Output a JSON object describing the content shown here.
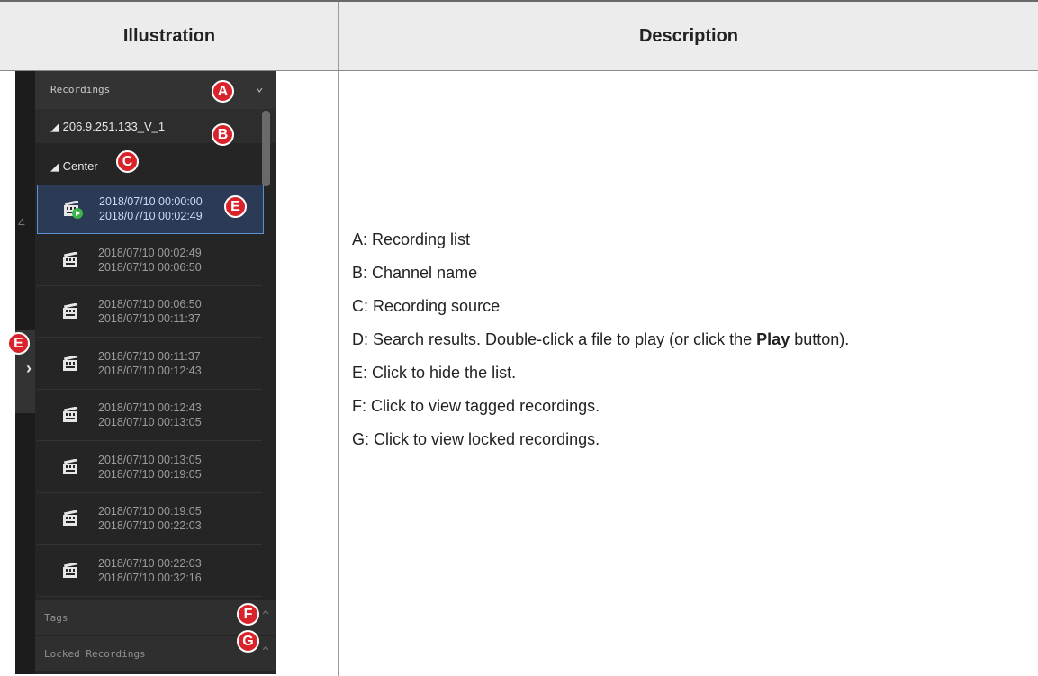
{
  "table": {
    "header": {
      "illustration": "Illustration",
      "description": "Description"
    }
  },
  "panel": {
    "recordings_label": "Recordings",
    "channel_name": "206.9.251.133_V_1",
    "source_name": "Center",
    "tags_label": "Tags",
    "locked_label": "Locked Recordings",
    "recordings": [
      {
        "start": "2018/07/10  00:00:00",
        "end": "2018/07/10  00:02:49",
        "selected": true
      },
      {
        "start": "2018/07/10  00:02:49",
        "end": "2018/07/10  00:06:50"
      },
      {
        "start": "2018/07/10  00:06:50",
        "end": "2018/07/10  00:11:37"
      },
      {
        "start": "2018/07/10  00:11:37",
        "end": "2018/07/10  00:12:43"
      },
      {
        "start": "2018/07/10  00:12:43",
        "end": "2018/07/10  00:13:05"
      },
      {
        "start": "2018/07/10  00:13:05",
        "end": "2018/07/10  00:19:05"
      },
      {
        "start": "2018/07/10  00:19:05",
        "end": "2018/07/10  00:22:03"
      },
      {
        "start": "2018/07/10  00:22:03",
        "end": "2018/07/10  00:32:16"
      }
    ],
    "callouts": {
      "a": "A",
      "b": "B",
      "c": "C",
      "e_list": "E",
      "e_side": "E",
      "f": "F",
      "g": "G"
    }
  },
  "description": {
    "a": "A: Recording list",
    "b": "B: Channel name",
    "c": "C: Recording source",
    "d_prefix": "D: Search results. Double-click a file to play (or click the ",
    "d_bold": "Play",
    "d_suffix": " button).",
    "e": "E: Click to hide the list.",
    "f": "F: Click to view tagged recordings.",
    "g": "G: Click to view locked recordings."
  },
  "colors": {
    "callout": "#d8232a",
    "panel_bg": "#252525",
    "selection": "#5b8fd6"
  }
}
